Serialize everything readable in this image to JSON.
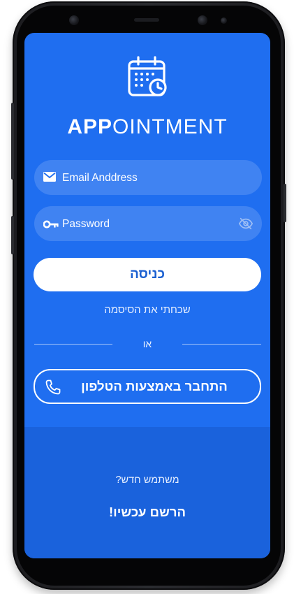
{
  "app": {
    "title_bold": "APP",
    "title_rest": "OINTMENT"
  },
  "login": {
    "email_placeholder": "Email Anddress",
    "password_placeholder": "Password",
    "submit_label": "כניסה",
    "forgot_label": "שכחתי את הסיסמה",
    "or_label": "או",
    "phone_login_label": "התחבר באמצעות הטלפון"
  },
  "signup": {
    "new_user_label": "משתמש חדש?",
    "register_label": "הרשם עכשיו!"
  },
  "icons": {
    "logo": "calendar-clock-icon",
    "email": "envelope-icon",
    "password": "key-icon",
    "visibility": "eye-off-icon",
    "phone": "phone-icon"
  },
  "colors": {
    "primary": "#1f6ef0",
    "primary_dark": "#1a62dc",
    "button_text": "#1a5fd0",
    "white": "#ffffff"
  }
}
